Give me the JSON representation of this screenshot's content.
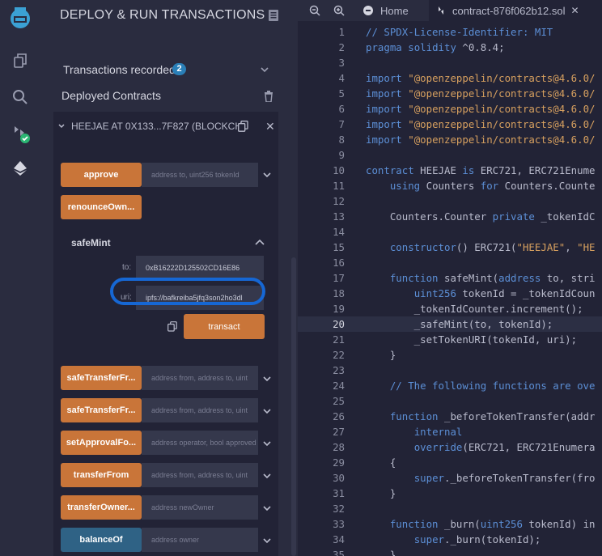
{
  "panel": {
    "title": "DEPLOY & RUN TRANSACTIONS",
    "transactions_label": "Transactions recorded",
    "transactions_count": "2",
    "deployed_label": "Deployed Contracts",
    "contract_name": "HEEJAE AT 0X133...7F827 (BLOCKCH",
    "close_glyph": "✕"
  },
  "functions_top": [
    {
      "label": "approve",
      "placeholder": "address to, uint256 tokenId",
      "color": "orange"
    },
    {
      "label": "renounceOwn...",
      "color": "orange"
    }
  ],
  "safemint": {
    "title": "safeMint",
    "to_label": "to:",
    "to_value": "0xB16222D125502CD16E86",
    "uri_label": "uri:",
    "uri_value": "ipfs://bafkreiba5jfq3son2ho3dl",
    "transact_label": "transact"
  },
  "functions_bottom": [
    {
      "label": "safeTransferFr...",
      "placeholder": "address from, address to, uint",
      "color": "orange"
    },
    {
      "label": "safeTransferFr...",
      "placeholder": "address from, address to, uint",
      "color": "orange"
    },
    {
      "label": "setApprovalFo...",
      "placeholder": "address operator, bool approved",
      "color": "orange"
    },
    {
      "label": "transferFrom",
      "placeholder": "address from, address to, uint",
      "color": "orange"
    },
    {
      "label": "transferOwner...",
      "placeholder": "address newOwner",
      "color": "orange"
    },
    {
      "label": "balanceOf",
      "placeholder": "address owner",
      "color": "blue"
    }
  ],
  "editor": {
    "tabs": [
      {
        "label": "Home"
      },
      {
        "label": "contract-876f062b12.sol",
        "close": "✕"
      }
    ],
    "current_line": 20,
    "lines": [
      "// SPDX-License-Identifier: MIT",
      "pragma solidity ^0.8.4;",
      "",
      "import \"@openzeppelin/contracts@4.6.0/",
      "import \"@openzeppelin/contracts@4.6.0/",
      "import \"@openzeppelin/contracts@4.6.0/",
      "import \"@openzeppelin/contracts@4.6.0/",
      "import \"@openzeppelin/contracts@4.6.0/",
      "",
      "contract HEEJAE is ERC721, ERC721Enume",
      "    using Counters for Counters.Counte",
      "",
      "    Counters.Counter private _tokenIdC",
      "",
      "    constructor() ERC721(\"HEEJAE\", \"HE",
      "",
      "    function safeMint(address to, stri",
      "        uint256 tokenId = _tokenIdCoun",
      "        _tokenIdCounter.increment();",
      "        _safeMint(to, tokenId);",
      "        _setTokenURI(tokenId, uri);",
      "    }",
      "",
      "    // The following functions are ove",
      "",
      "    function _beforeTokenTransfer(addr",
      "        internal",
      "        override(ERC721, ERC721Enumera",
      "    {",
      "        super._beforeTokenTransfer(fro",
      "    }",
      "",
      "    function _burn(uint256 tokenId) in",
      "        super._burn(tokenId);",
      "    }"
    ]
  },
  "colors": {
    "accent_orange": "#c97539",
    "accent_blue": "#2f6285",
    "badge": "#2a7fb7",
    "highlight_ring": "#1667d4",
    "logo_teal": "#3ba1d4",
    "check_green": "#2bb673"
  }
}
